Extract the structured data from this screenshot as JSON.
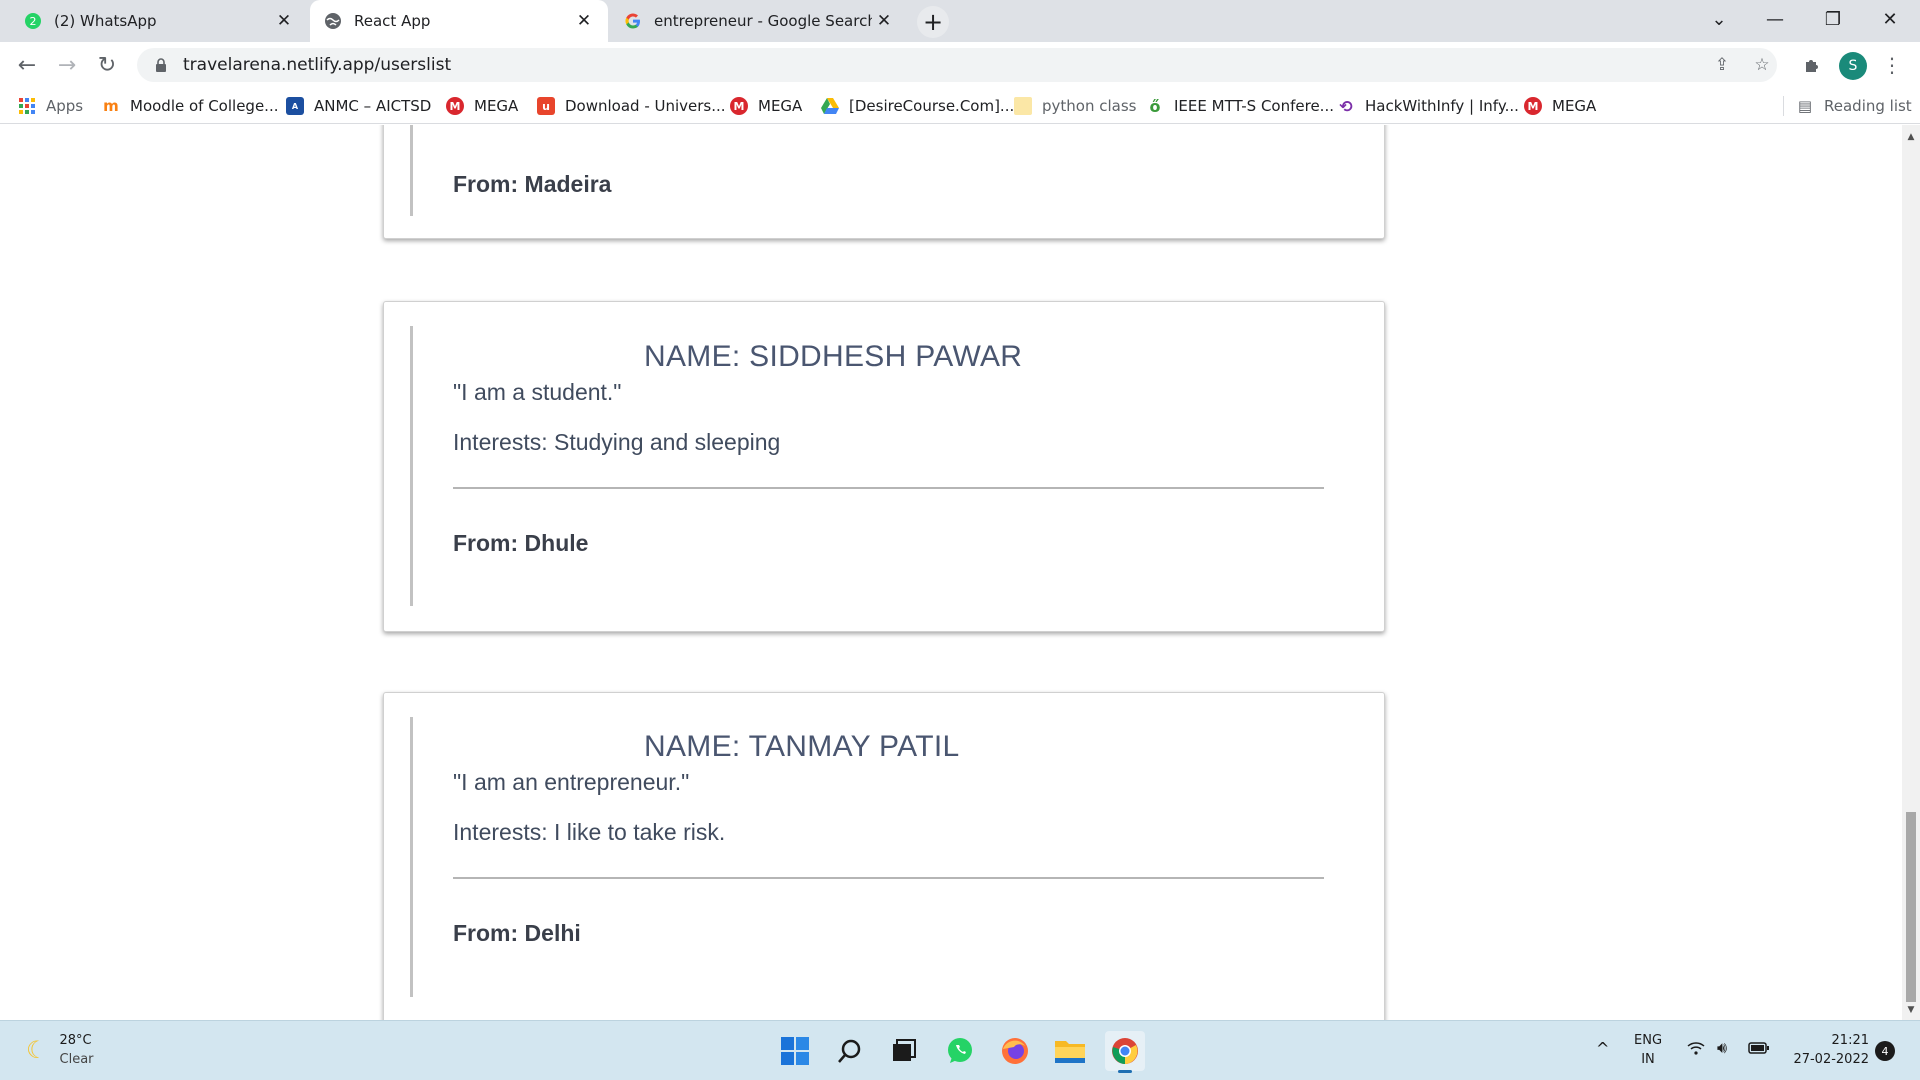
{
  "browser": {
    "tabs": [
      {
        "title": "(2) WhatsApp",
        "badge": "2"
      },
      {
        "title": "React App"
      },
      {
        "title": "entrepreneur - Google Search"
      }
    ],
    "url": "travelarena.netlify.app/userslist",
    "profile_initial": "S",
    "bookmarks": [
      {
        "label": "Apps",
        "icon": "apps-grid-icon"
      },
      {
        "label": "Moodle of College...",
        "icon": "moodle-icon"
      },
      {
        "label": "ANMC – AICTSD",
        "icon": "anmc-icon"
      },
      {
        "label": "MEGA",
        "icon": "mega-icon"
      },
      {
        "label": "Download - Univers...",
        "icon": "download-icon"
      },
      {
        "label": "MEGA",
        "icon": "mega-icon"
      },
      {
        "label": "[DesireCourse.Com]...",
        "icon": "drive-icon"
      },
      {
        "label": "python class",
        "icon": "folder-icon"
      },
      {
        "label": "IEEE MTT-S Confere...",
        "icon": "ieee-icon"
      },
      {
        "label": "HackWithInfy | Infy...",
        "icon": "hackwithinfy-icon"
      },
      {
        "label": "MEGA",
        "icon": "mega-icon"
      }
    ],
    "reading_list": "Reading list"
  },
  "users": [
    {
      "from": "From: Madeira"
    },
    {
      "name": "NAME: SIDDHESH PAWAR",
      "quote": "\"I am a student.\"",
      "interests": "Interests: Studying and sleeping",
      "from": "From: Dhule"
    },
    {
      "name": "NAME: TANMAY PATIL",
      "quote": "\"I am an entrepreneur.\"",
      "interests": "Interests: I like to take risk.",
      "from": "From: Delhi"
    }
  ],
  "taskbar": {
    "weather_temp": "28°C",
    "weather_desc": "Clear",
    "lang_1": "ENG",
    "lang_2": "IN",
    "time": "21:21",
    "date": "27-02-2022",
    "notifications": "4"
  }
}
